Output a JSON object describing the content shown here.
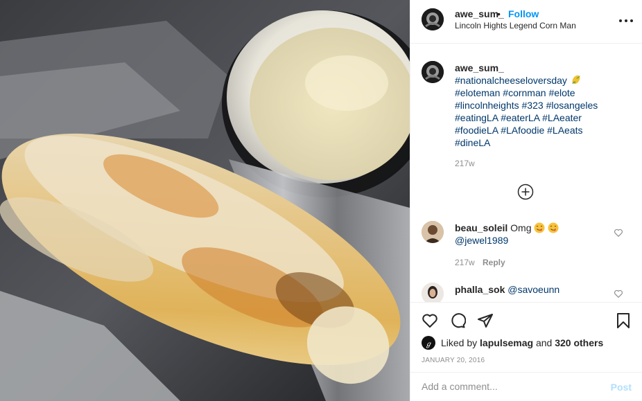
{
  "post": {
    "username": "awe_sum_",
    "separator": "•",
    "follow_label": "Follow",
    "location": "Lincoln Hights Legend Corn Man",
    "more_icon": "more-options-icon"
  },
  "caption": {
    "username": "awe_sum_",
    "line1": "#nationalcheeseloversday",
    "tags": [
      "#eloteman",
      "#cornman",
      "#elote",
      "#lincolnheights",
      "#323",
      "#losangeles",
      "#eatingLA",
      "#eaterLA",
      "#LAeater",
      "#foodieLA",
      "#LAfoodie",
      "#LAeats",
      "#dineLA"
    ],
    "time": "217w"
  },
  "comments": [
    {
      "username": "beau_soleil",
      "text": "Omg",
      "mention": "@jewel1989",
      "time": "217w",
      "reply_label": "Reply"
    },
    {
      "username": "phalla_sok",
      "mention": "@savoeunn"
    }
  ],
  "likes": {
    "prefix": "Liked by",
    "user": "lapulsemag",
    "joiner": "and",
    "others": "320 others",
    "avatar_initial": "ℊ"
  },
  "date": "JANUARY 20, 2016",
  "add_comment": {
    "placeholder": "Add a comment...",
    "post_label": "Post"
  },
  "colors": {
    "link": "#00376b",
    "follow": "#0095f6",
    "muted": "#8e8e8e",
    "post_disabled": "#b2dffc"
  }
}
